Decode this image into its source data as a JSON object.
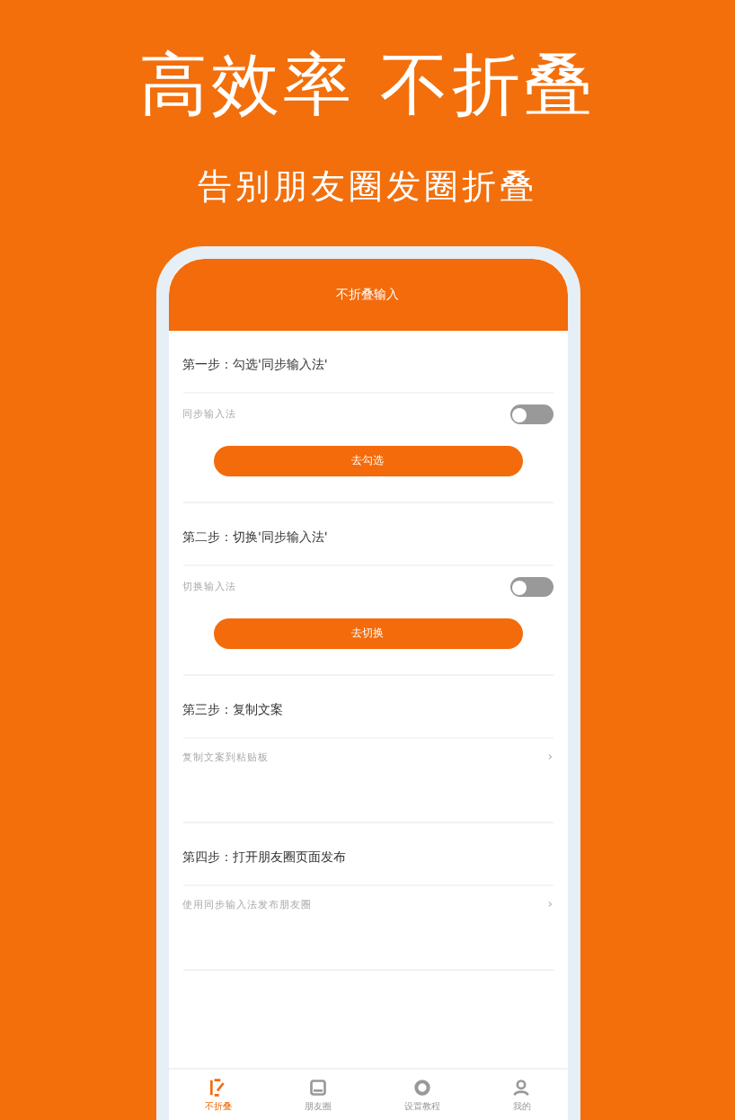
{
  "headline": "高效率 不折叠",
  "subtitle": "告别朋友圈发圈折叠",
  "screen": {
    "title": "不折叠输入",
    "steps": [
      {
        "kind": "toggle",
        "heading": "第一步：勾选'同步输入法'",
        "label": "同步输入法",
        "on": false,
        "button": "去勾选"
      },
      {
        "kind": "toggle",
        "heading": "第二步：切换'同步输入法'",
        "label": "切换输入法",
        "on": false,
        "button": "去切换"
      },
      {
        "kind": "link",
        "heading": "第三步：复制文案",
        "label": "复制文案到粘贴板",
        "arrow": "›"
      },
      {
        "kind": "link",
        "heading": "第四步：打开朋友圈页面发布",
        "label": "使用同步输入法发布朋友圈",
        "arrow": "›"
      }
    ],
    "tabs": [
      {
        "label": "不折叠",
        "selected": true
      },
      {
        "label": "朋友圈",
        "selected": false
      },
      {
        "label": "设置教程",
        "selected": false
      },
      {
        "label": "我的",
        "selected": false
      }
    ]
  }
}
